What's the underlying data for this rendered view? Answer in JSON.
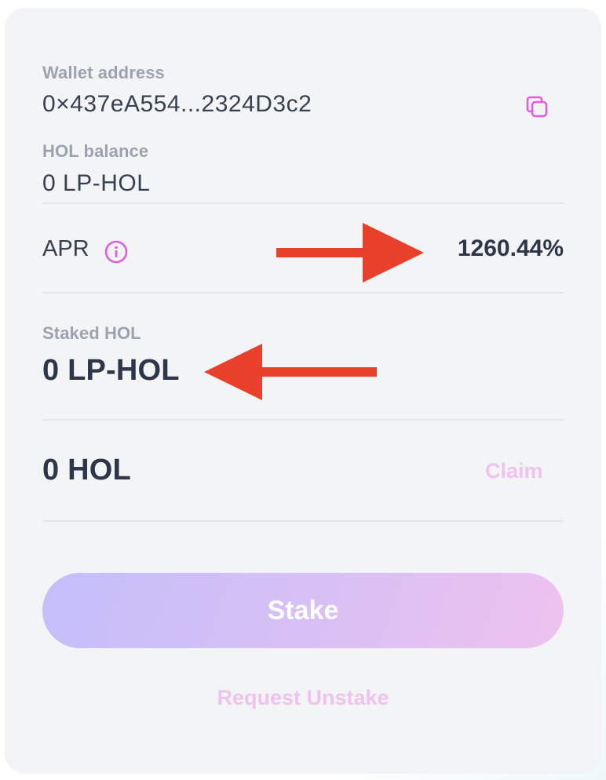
{
  "wallet": {
    "label": "Wallet address",
    "address": "0×437eA554...2324D3c2",
    "copy_icon": "copy-icon"
  },
  "balance": {
    "label": "HOL balance",
    "value": "0 LP-HOL"
  },
  "apr": {
    "label": "APR",
    "value": "1260.44%",
    "info_icon": "info-icon"
  },
  "staked": {
    "label": "Staked HOL",
    "value": "0 LP-HOL"
  },
  "reward": {
    "value": "0 HOL",
    "claim_label": "Claim"
  },
  "actions": {
    "stake_label": "Stake",
    "unstake_label": "Request Unstake"
  },
  "colors": {
    "accent": "#e25ee0",
    "annotation_arrow": "#e8402a",
    "card_bg": "#f3f4f6"
  }
}
